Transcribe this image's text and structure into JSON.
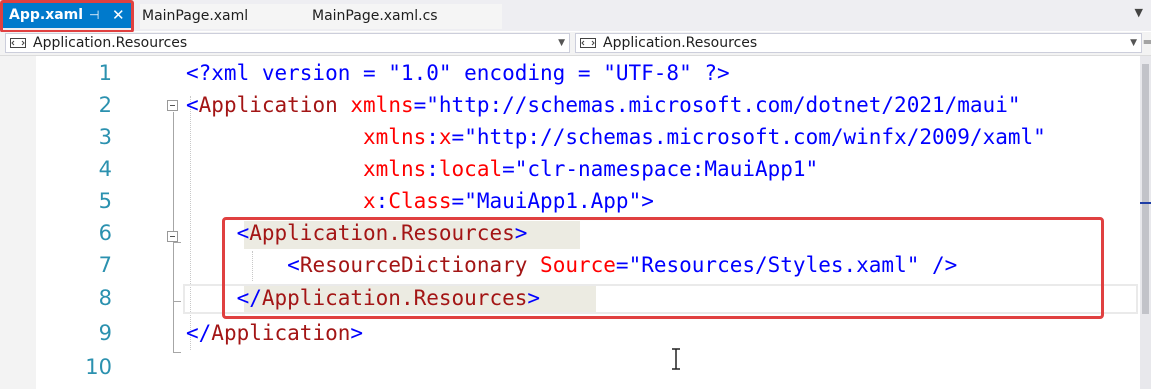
{
  "tabs": [
    {
      "label": "App.xaml",
      "active": true,
      "pin_icon": "pin-icon",
      "close_icon": "close-icon"
    },
    {
      "label": "MainPage.xaml",
      "active": false
    },
    {
      "label": "MainPage.xaml.cs",
      "active": false
    }
  ],
  "navbar": {
    "left_member": "Application.Resources",
    "right_member": "Application.Resources"
  },
  "colors": {
    "accent": "#007acc",
    "highlight_box": "#e04040",
    "line_number": "#2b91af",
    "xml_element": "#a31515",
    "xml_attribute": "#ff0000",
    "xml_value": "#0000ff"
  },
  "editor": {
    "line_numbers": [
      "1",
      "2",
      "3",
      "4",
      "5",
      "6",
      "7",
      "8",
      "9",
      "10"
    ],
    "lines": [
      {
        "decl": "<?xml version = \"1.0\" encoding = \"UTF-8\" ?>"
      },
      {
        "lt": "<",
        "el": "Application",
        "a1": "xmlns",
        "eq1": "=",
        "v1": "\"http://schemas.microsoft.com/dotnet/2021/maui\""
      },
      {
        "indent": "              ",
        "a1": "xmlns",
        "colon": ":",
        "a2": "x",
        "eq1": "=",
        "v1": "\"http://schemas.microsoft.com/winfx/2009/xaml\""
      },
      {
        "indent": "              ",
        "a1": "xmlns",
        "colon": ":",
        "a2": "local",
        "eq1": "=",
        "v1": "\"clr-namespace:MauiApp1\""
      },
      {
        "indent": "              ",
        "a1": "x",
        "colon": ":",
        "a2": "Class",
        "eq1": "=",
        "v1": "\"MauiApp1.App\"",
        "gt": ">"
      },
      {
        "indent": "    ",
        "lt": "<",
        "el": "Application.Resources",
        "gt": ">"
      },
      {
        "indent": "        ",
        "lt": "<",
        "el": "ResourceDictionary",
        "a1": "Source",
        "eq1": "=",
        "v1": "\"Resources/Styles.xaml\"",
        "end": " />"
      },
      {
        "indent": "    ",
        "lt": "</",
        "el": "Application.Resources",
        "gt": ">"
      },
      {
        "lt": "</",
        "el": "Application",
        "gt": ">"
      },
      {}
    ]
  }
}
